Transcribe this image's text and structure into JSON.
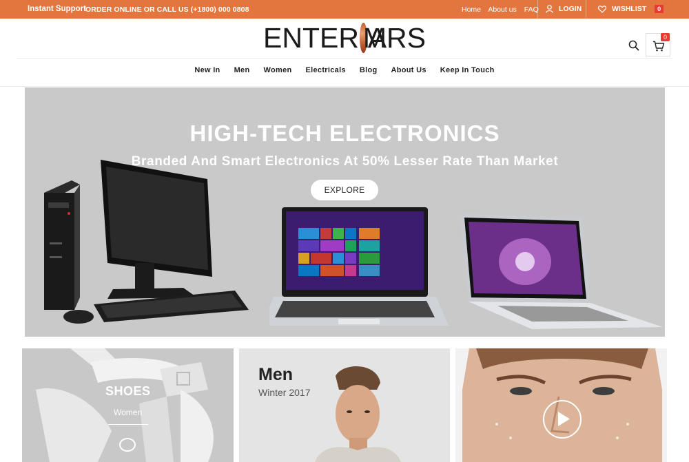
{
  "topbar": {
    "support": "Instant Support",
    "order": "ORDER ONLINE OR CALL US (+1800) 000 0808",
    "links": [
      "Home",
      "About us",
      "FAQ"
    ],
    "login": "LOGIN",
    "wishlist": "WISHLIST",
    "wishlist_count": "0",
    "bg_color": "#e2763e"
  },
  "header": {
    "logo_left": "ENTER ",
    "logo_m": "M",
    "logo_right": "ARS",
    "cart_count": "0"
  },
  "nav": [
    "New In",
    "Men",
    "Women",
    "Electricals",
    "Blog",
    "About Us",
    "Keep In Touch"
  ],
  "hero": {
    "title": "HIGH-TECH ELECTRONICS",
    "subtitle": "Branded And Smart Electronics At 50% Lesser Rate Than Market",
    "button": "EXPLORE"
  },
  "tiles": {
    "shoes_title": "SHOES",
    "shoes_sub": "Women",
    "men_title": "Men",
    "men_sub": "Winter 2017"
  },
  "icons": {
    "user": "user-icon",
    "heart": "heart-icon",
    "search": "search-icon",
    "cart": "cart-icon",
    "play": "play-icon"
  }
}
